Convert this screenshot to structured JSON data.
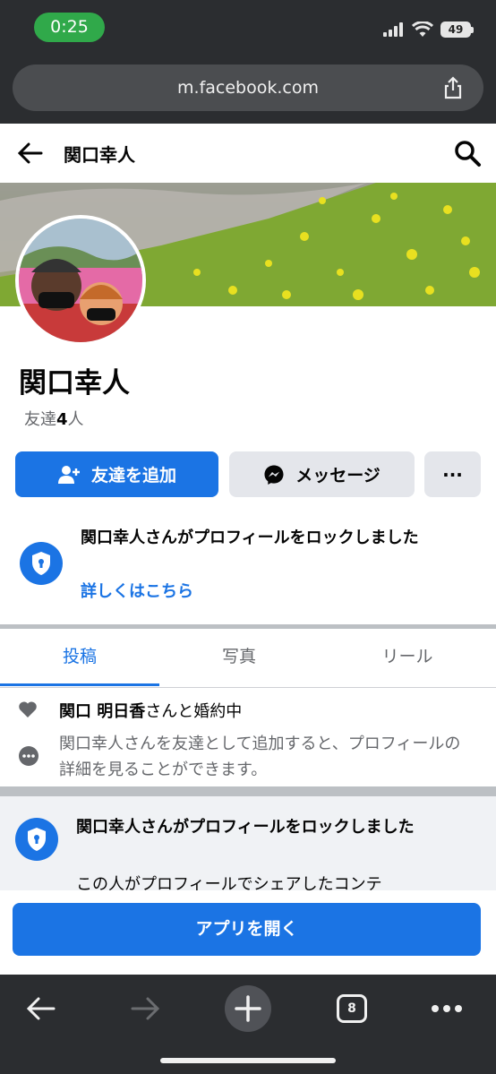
{
  "status": {
    "time": "0:25",
    "battery": "49"
  },
  "browser_url": "m.facebook.com",
  "header": {
    "title": "関口幸人"
  },
  "profile": {
    "name": "関口幸人",
    "friends_prefix": "友達",
    "friends_count": "4",
    "friends_suffix": "人"
  },
  "actions": {
    "add_friend": "友達を追加",
    "message": "メッセージ",
    "more": "···"
  },
  "lock_notice": {
    "title": "関口幸人さんがプロフィールをロックしました",
    "link": "詳しくはこちら"
  },
  "tabs": [
    "投稿",
    "写真",
    "リール"
  ],
  "info": {
    "relationship_name": "関口 明日香",
    "relationship_suffix": "さんと婚約中",
    "add_note": "関口幸人さんを友達として追加すると、プロフィールの詳細を見ることができます。"
  },
  "lock_card": {
    "title": "関口幸人さんがプロフィールをロックしました",
    "desc": "この人がプロフィールでシェアしたコンテ"
  },
  "open_app": "アプリを開く",
  "browser_nav": {
    "tab_count": "8"
  },
  "colors": {
    "accent": "#1b74e4",
    "chrome": "#2b2d30",
    "status_pill": "#30a94a"
  }
}
